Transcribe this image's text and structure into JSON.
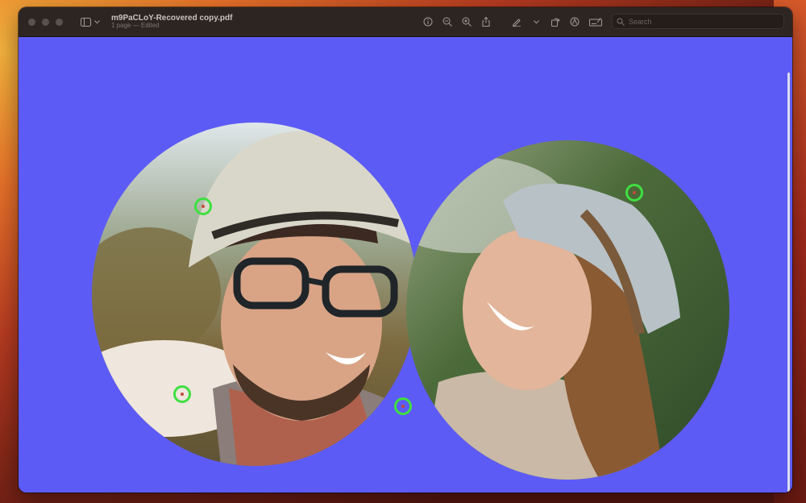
{
  "window": {
    "title": "m9PaCLoY-Recovered copy.pdf",
    "subtitle": "1 page — Edited"
  },
  "toolbar": {
    "icons": [
      "info-icon",
      "zoom-out-icon",
      "zoom-in-icon",
      "share-icon",
      "markup-pen-icon",
      "chevron-down-icon",
      "rotate-icon",
      "markup-circle-icon",
      "form-fill-icon"
    ]
  },
  "search": {
    "placeholder": "Search",
    "value": ""
  },
  "colors": {
    "canvas": "#5d5bf5",
    "handle": "#3ee040",
    "titlebar": "#2d2521"
  },
  "photos": [
    {
      "description": "smiling man with hat and glasses"
    },
    {
      "description": "laughing woman with hat"
    }
  ]
}
